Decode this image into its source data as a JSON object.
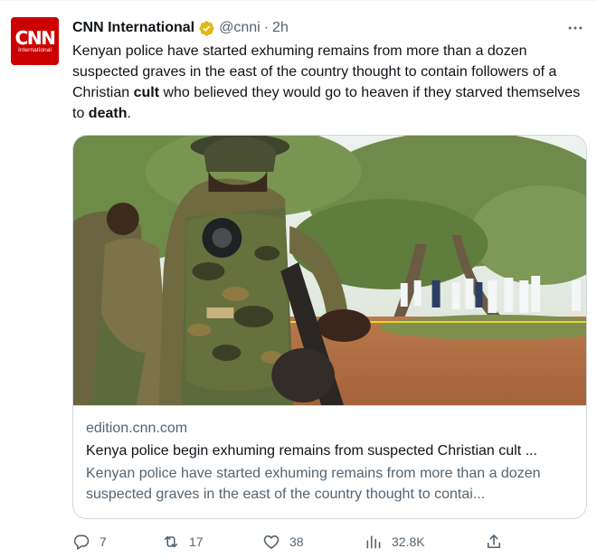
{
  "author": {
    "name": "CNN International",
    "handle": "@cnni",
    "time": "2h",
    "avatar_main": "CNN",
    "avatar_sub": "International"
  },
  "tweet": {
    "part1": "Kenyan police have started exhuming remains from more than a dozen suspected graves in the east of the country thought to contain followers of a Christian ",
    "bold1": "cult",
    "part2": " who believed they would go to heaven if they starved themselves to ",
    "bold2": "death",
    "part3": "."
  },
  "card": {
    "domain": "edition.cnn.com",
    "title": "Kenya police begin exhuming remains from suspected Christian cult ...",
    "description": "Kenyan police have started exhuming remains from more than a dozen suspected graves in the east of the country thought to contai..."
  },
  "actions": {
    "replies": "7",
    "retweets": "17",
    "likes": "38",
    "views": "32.8K"
  },
  "colors": {
    "brand": "#cc0000",
    "verified": "#e2b719",
    "muted": "#536471",
    "text": "#0f1419",
    "border": "#cfd9de"
  },
  "icons": {
    "more": "more-icon",
    "verified": "verified-badge-icon",
    "reply": "reply-icon",
    "retweet": "retweet-icon",
    "like": "like-icon",
    "views": "views-icon",
    "share": "share-icon"
  }
}
